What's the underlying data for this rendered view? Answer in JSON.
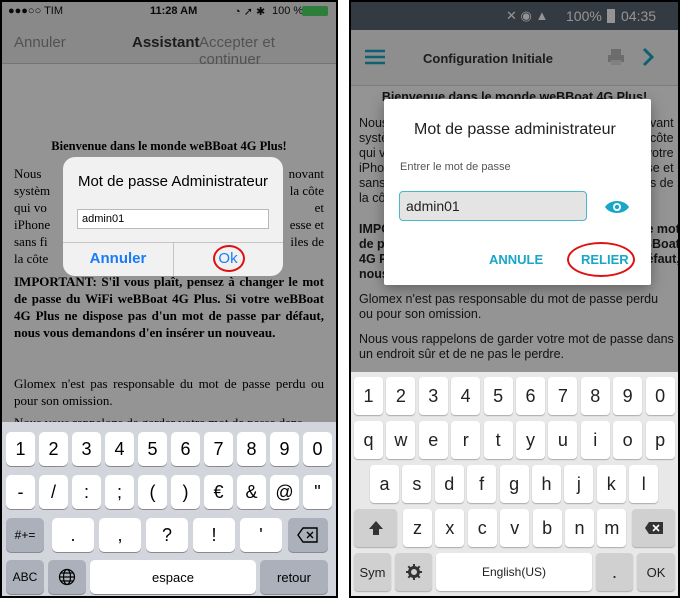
{
  "ios": {
    "status": {
      "carrier": "●●●○○ TIM",
      "time": "11:28 AM",
      "battery": "100 %"
    },
    "nav": {
      "cancel": "Annuler",
      "title": "Assistant",
      "accept": "Accepter et continuer"
    },
    "doc": {
      "heading": "Bienvenue dans le monde weBBoat 4G Plus!",
      "para1_left": "Nous\nsystèm\nqui vo\niPhone\nsans fi\nla côte",
      "para1_right": "novant\nla côte\net\nesse et\niles de",
      "important": "IMPORTANT: S'il vous plaît, pensez à changer le mot de passe du WiFi weBBoat 4G Plus. Si votre weBBoat 4G Plus ne dispose pas d'un mot de passe par défaut, nous vous demandons d'en insérer un nouveau.",
      "glomex": "Glomex n'est pas responsable du mot de passe perdu ou pour son omission.",
      "reminder": "Nous vous rappelons de garder votre mot de passe dans"
    },
    "alert": {
      "title": "Mot de passe Administrateur",
      "value": "admin01",
      "cancel": "Annuler",
      "ok": "Ok"
    },
    "keyboard": {
      "row1": [
        "1",
        "2",
        "3",
        "4",
        "5",
        "6",
        "7",
        "8",
        "9",
        "0"
      ],
      "row2": [
        "-",
        "/",
        ":",
        ";",
        "(",
        ")",
        "€",
        "&",
        "@",
        "\""
      ],
      "row3": [
        ".",
        ",",
        "?",
        "!",
        "'"
      ],
      "shift": "#+=",
      "abc": "ABC",
      "space": "espace",
      "return": "retour"
    }
  },
  "android": {
    "status": {
      "text": "100%",
      "time": "04:35"
    },
    "bar": {
      "title": "Configuration Initiale"
    },
    "body": {
      "heading": "Bienvenue dans le monde weBBoat 4G Plus!",
      "left_lines": [
        "Nous",
        "systè",
        "qui v",
        "iPhon",
        "sans",
        "la cô"
      ],
      "right_lines": [
        "vant",
        "côte",
        "votre",
        "se et",
        "es de"
      ],
      "imp_left": [
        "IMPO",
        "de pa",
        "4G P",
        "nous"
      ],
      "imp_right": [
        "e mot",
        "BBoat",
        "éfaut,"
      ],
      "glomex": "Glomex n'est pas responsable du mot de passe perdu ou pour son omission.",
      "reminder": "Nous vous rappelons de garder votre mot de passe dans un endroit sûr et de ne pas le perdre."
    },
    "dialog": {
      "title": "Mot de passe administrateur",
      "label": "Entrer le mot de passe",
      "value": "admin01",
      "cancel": "ANNULE",
      "ok": "RELIER"
    },
    "keyboard": {
      "row1": [
        "1",
        "2",
        "3",
        "4",
        "5",
        "6",
        "7",
        "8",
        "9",
        "0"
      ],
      "row2": [
        "q",
        "w",
        "e",
        "r",
        "t",
        "y",
        "u",
        "i",
        "o",
        "p"
      ],
      "row3": [
        "a",
        "s",
        "d",
        "f",
        "g",
        "h",
        "j",
        "k",
        "l"
      ],
      "row4": [
        "z",
        "x",
        "c",
        "v",
        "b",
        "n",
        "m"
      ],
      "sym": "Sym",
      "lang": "English(US)",
      "period": ".",
      "ok": "OK"
    }
  },
  "colors": {
    "ios_blue": "#1a7cf5",
    "android_teal": "#1aa6c7",
    "highlight_red": "#e01010"
  }
}
